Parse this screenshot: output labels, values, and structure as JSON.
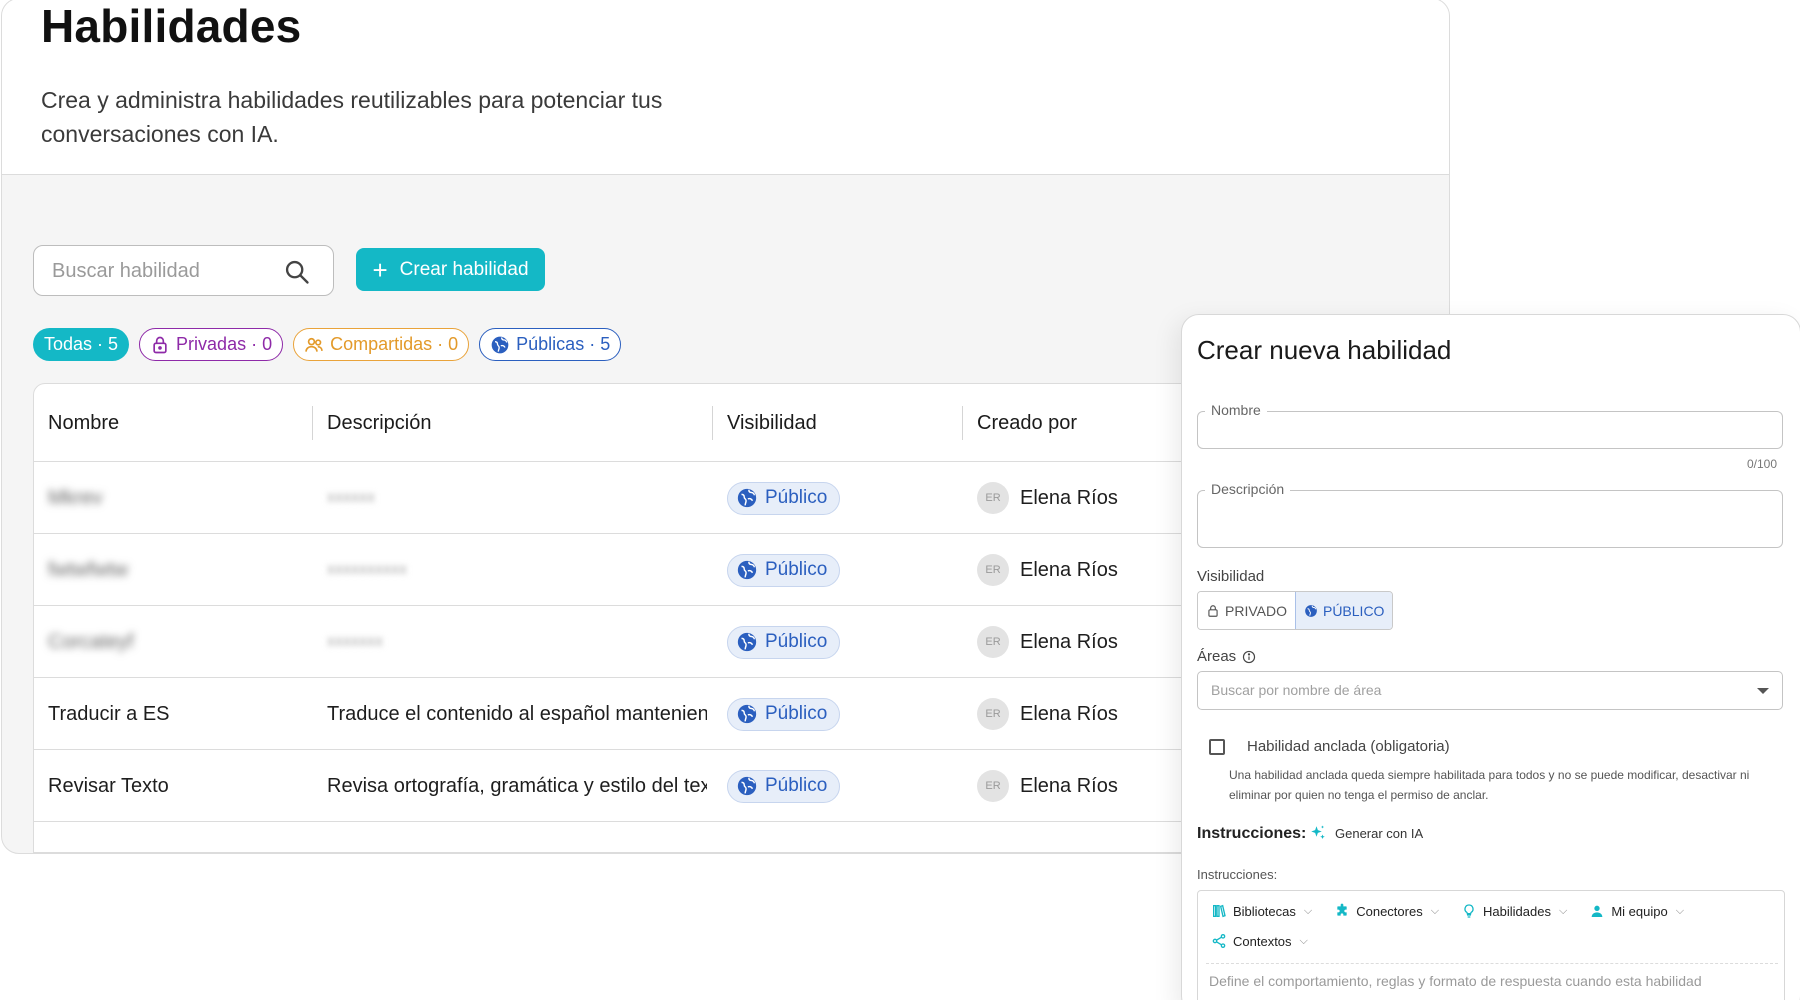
{
  "header": {
    "title": "Habilidades",
    "subtitle": "Crea y administra habilidades reutilizables para potenciar tus conversaciones con IA."
  },
  "search": {
    "placeholder": "Buscar habilidad"
  },
  "create_button": {
    "label": "Crear habilidad"
  },
  "filters": [
    {
      "label": "Todas · 5",
      "color": "#14b8c6"
    },
    {
      "label": "Privadas · 0",
      "color": "#8e2aa8"
    },
    {
      "label": "Compartidas · 0",
      "color": "#e39a2a"
    },
    {
      "label": "Públicas · 5",
      "color": "#2b5fbf"
    }
  ],
  "table": {
    "columns": [
      "Nombre",
      "Descripción",
      "Visibilidad",
      "Creado por"
    ],
    "rows": [
      {
        "name": "Mkrev",
        "description": "xxxxxx",
        "visibility": "Público",
        "creator_initials": "ER",
        "creator": "Elena Ríos",
        "blurred": true
      },
      {
        "name": "fwtwfwtw",
        "description": "xxxxxxxxxx",
        "visibility": "Público",
        "creator_initials": "ER",
        "creator": "Elena Ríos",
        "blurred": true
      },
      {
        "name": "Corcateyf",
        "description": "xxxxxxx",
        "visibility": "Público",
        "creator_initials": "ER",
        "creator": "Elena Ríos",
        "blurred": true
      },
      {
        "name": "Traducir a ES",
        "description": "Traduce el contenido al español manteniendo",
        "visibility": "Público",
        "creator_initials": "ER",
        "creator": "Elena Ríos",
        "blurred": false
      },
      {
        "name": "Revisar Texto",
        "description": "Revisa ortografía, gramática y estilo del texto",
        "visibility": "Público",
        "creator_initials": "ER",
        "creator": "Elena Ríos",
        "blurred": false
      }
    ]
  },
  "panel": {
    "title": "Crear nueva habilidad",
    "name_label": "Nombre",
    "name_counter": "0/100",
    "description_label": "Descripción",
    "visibility_label": "Visibilidad",
    "visibility_options": [
      "PRIVADO",
      "PÚBLICO"
    ],
    "visibility_selected": "PÚBLICO",
    "areas_label": "Áreas",
    "areas_placeholder": "Buscar por nombre de área",
    "pinned_label": "Habilidad anclada (obligatoria)",
    "pinned_help": "Una habilidad anclada queda siempre habilitada para todos y no se puede modificar, desactivar ni eliminar por quien no tenga el permiso de anclar.",
    "instructions_title": "Instrucciones:",
    "generate_ai": "Generar con IA",
    "instructions_small": "Instrucciones:",
    "toolbar": [
      {
        "label": "Bibliotecas",
        "icon": "books-icon"
      },
      {
        "label": "Conectores",
        "icon": "puzzle-icon"
      },
      {
        "label": "Habilidades",
        "icon": "lightbulb-icon"
      },
      {
        "label": "Mi equipo",
        "icon": "person-icon"
      },
      {
        "label": "Contextos",
        "icon": "share-nodes-icon"
      }
    ],
    "editor_placeholder": "Define el comportamiento, reglas y formato de respuesta cuando esta habilidad"
  },
  "colors": {
    "accent": "#14b8c6",
    "public_blue": "#2b5fbf"
  }
}
